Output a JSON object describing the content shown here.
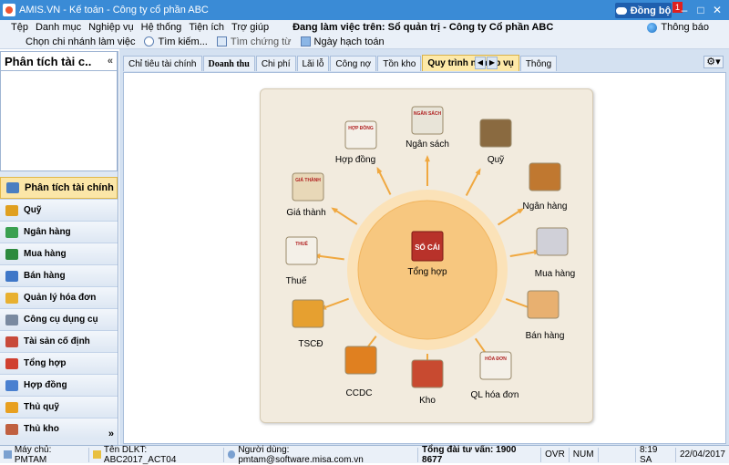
{
  "window": {
    "title": "AMIS.VN - Kế toán - Công ty cổ phần ABC",
    "sync_label": "Đồng bộ",
    "sync_badge": "1"
  },
  "menu": {
    "items": [
      "Tệp",
      "Danh mục",
      "Nghiệp vụ",
      "Hệ thống",
      "Tiện ích",
      "Trợ giúp"
    ],
    "context": "Đang làm việc trên: Sổ quản trị - Công ty Cổ phần ABC",
    "notify_label": "Thông báo"
  },
  "toolbar": {
    "items": [
      "Chọn chi nhánh làm việc",
      "Tìm kiếm...",
      "Tìm chứng từ",
      "Ngày hạch toán"
    ]
  },
  "left_panel": {
    "title": "Phân tích tài c..",
    "collapse": "«",
    "nav": [
      {
        "label": "Phân tích tài chính",
        "color": "#4a7fc1"
      },
      {
        "label": "Quỹ",
        "color": "#e0a020"
      },
      {
        "label": "Ngân hàng",
        "color": "#3aa050"
      },
      {
        "label": "Mua hàng",
        "color": "#2d8a3e"
      },
      {
        "label": "Bán hàng",
        "color": "#3f77c8"
      },
      {
        "label": "Quản lý hóa đơn",
        "color": "#e8b030"
      },
      {
        "label": "Công cụ dụng cụ",
        "color": "#7a8aa0"
      },
      {
        "label": "Tài sản cố định",
        "color": "#c84a3a"
      },
      {
        "label": "Tổng hợp",
        "color": "#d04030"
      },
      {
        "label": "Hợp đồng",
        "color": "#4a80d0"
      },
      {
        "label": "Thủ quỹ",
        "color": "#e8a020"
      },
      {
        "label": "Thủ kho",
        "color": "#c06040"
      }
    ],
    "more": "»"
  },
  "tabs": [
    {
      "label": "Chỉ tiêu tài chính",
      "serif": false
    },
    {
      "label": "Doanh thu",
      "serif": true
    },
    {
      "label": "Chi phí",
      "serif": false
    },
    {
      "label": "Lãi lỗ",
      "serif": false
    },
    {
      "label": "Công nợ",
      "serif": false
    },
    {
      "label": "Tồn kho",
      "serif": false
    },
    {
      "label": "Quy trình nghiệp vụ",
      "serif": false
    },
    {
      "label": "Thông",
      "serif": false
    }
  ],
  "diagram": {
    "center_label": "Tổng hợp",
    "center_badge": "SỔ CÁI",
    "nodes": [
      {
        "label": "Ngân sách",
        "icon": "budget-icon",
        "tag": "NGÂN SÁCH"
      },
      {
        "label": "Quỹ",
        "icon": "safe-icon",
        "tag": ""
      },
      {
        "label": "Ngân hàng",
        "icon": "bank-icon",
        "tag": ""
      },
      {
        "label": "Mua hàng",
        "icon": "cart-icon",
        "tag": ""
      },
      {
        "label": "Bán hàng",
        "icon": "sale-icon",
        "tag": ""
      },
      {
        "label": "QL hóa đơn",
        "icon": "invoice-icon",
        "tag": "HÓA ĐƠN"
      },
      {
        "label": "Kho",
        "icon": "warehouse-icon",
        "tag": ""
      },
      {
        "label": "CCDC",
        "icon": "tools-icon",
        "tag": ""
      },
      {
        "label": "TSCĐ",
        "icon": "house-icon",
        "tag": ""
      },
      {
        "label": "Thuế",
        "icon": "tax-icon",
        "tag": "THUẾ"
      },
      {
        "label": "Giá thành",
        "icon": "costing-icon",
        "tag": "GIÁ THÀNH"
      },
      {
        "label": "Hợp đồng",
        "icon": "contract-icon",
        "tag": "HỢP ĐỒNG"
      }
    ]
  },
  "status": {
    "server": "Máy chủ: PMTAM",
    "db": "Tên DLKT: ABC2017_ACT04",
    "user": "Người dùng: pmtam@software.misa.com.vn",
    "hotline": "Tổng đài tư vấn: 1900 8677",
    "ovr": "OVR",
    "num": "NUM",
    "time": "8:19 SA",
    "date": "22/04/2017"
  }
}
